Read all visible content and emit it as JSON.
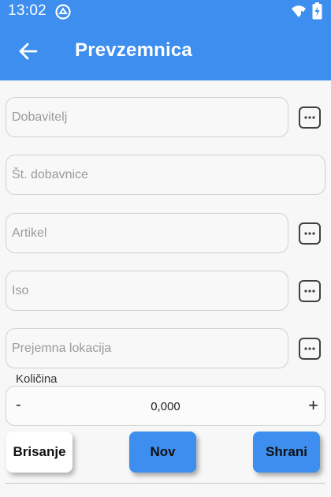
{
  "status_bar": {
    "time": "13:02",
    "background": "#3d8eee"
  },
  "app_bar": {
    "title": "Prevzemnica",
    "background": "#3d8eee"
  },
  "fields": [
    {
      "placeholder": "Dobavitelj",
      "has_lookup": true
    },
    {
      "placeholder": "Št. dobavnice",
      "has_lookup": false
    },
    {
      "placeholder": "Artikel",
      "has_lookup": true
    },
    {
      "placeholder": "Iso",
      "has_lookup": true
    },
    {
      "placeholder": "Prejemna lokacija",
      "has_lookup": true
    }
  ],
  "quantity": {
    "label": "Količina",
    "minus": "-",
    "value": "0,000",
    "plus": "+"
  },
  "buttons": {
    "delete": "Brisanje",
    "new": "Nov",
    "save": "Shrani"
  },
  "icons": {
    "back": "arrow-left-icon",
    "lookup": "more-horizontal-icon",
    "wifi": "wifi-icon",
    "battery": "battery-charging-icon",
    "app": "app-notification-icon"
  }
}
